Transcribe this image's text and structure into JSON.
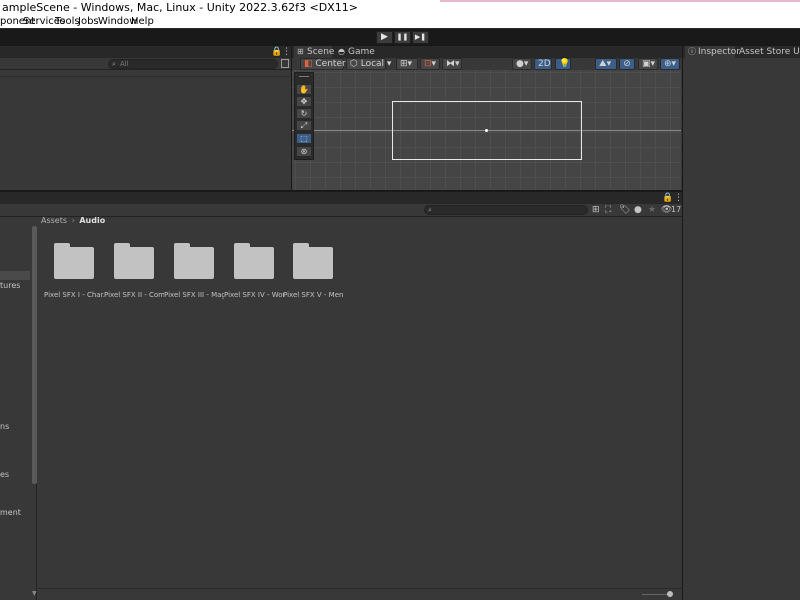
{
  "window": {
    "title": "ampleScene - Windows, Mac, Linux - Unity 2022.3.62f3 <DX11>"
  },
  "menu": [
    "ponent",
    "Services",
    "Tools",
    "Jobs",
    "Window",
    "Help"
  ],
  "toolbar": {
    "play_icon": "▶",
    "pause_icon": "❚❚",
    "step_icon": "▶❚"
  },
  "hierarchy": {
    "search_placeholder": "All"
  },
  "scene": {
    "tabs": [
      {
        "label": "Scene",
        "icon": "grid-icon"
      },
      {
        "label": "Game",
        "icon": "gamepad-icon"
      }
    ],
    "pivot": "Center",
    "space": "Local",
    "mode_2d": "2D"
  },
  "inspector": {
    "tabs": [
      "Inspector",
      "Asset Store Uploade"
    ]
  },
  "project": {
    "breadcrumb": [
      "Assets",
      "Audio"
    ],
    "visible_count": "17",
    "sidebar_fragments": [
      "tures",
      "ns",
      "es",
      "ment"
    ],
    "folders": [
      "Pixel SFX I - Char...",
      "Pixel SFX II - Com...",
      "Pixel SFX III - Mag...",
      "Pixel SFX IV - Wor...",
      "Pixel SFX V - Men..."
    ]
  },
  "colors": {
    "accent": "#3b5f88",
    "panel": "#383838",
    "background": "#191919",
    "folder": "#c2c2c2"
  }
}
